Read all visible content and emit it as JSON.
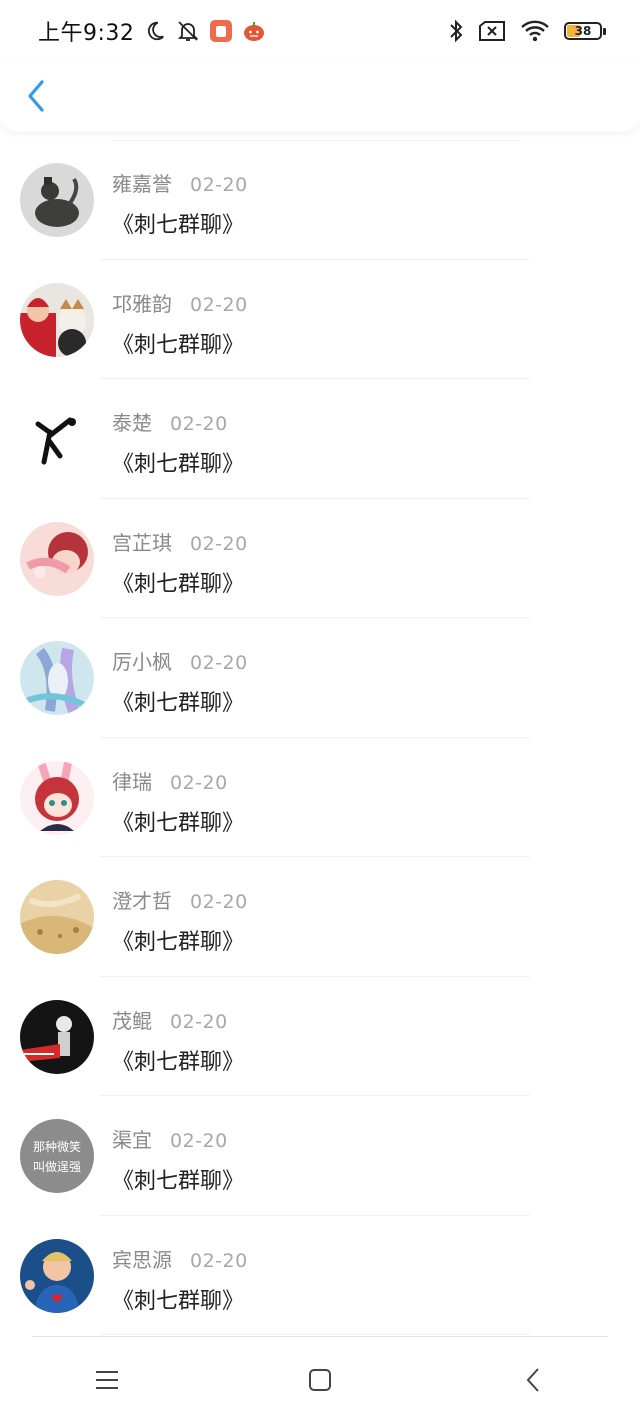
{
  "status_bar": {
    "time": "上午9:32",
    "battery_level": "38",
    "battery_fraction": 0.38,
    "icons": [
      "moon-icon",
      "bell-off-icon",
      "app-notification-icon",
      "pumpkin-icon",
      "bluetooth-icon",
      "sim-off-icon",
      "wifi-icon",
      "battery-icon"
    ]
  },
  "header": {
    "back_icon": "chevron-left-icon",
    "accent_color": "#2f9bf0"
  },
  "messages": [
    {
      "name": "雍嘉誉",
      "date": "02-20",
      "text": "《刺七群聊》",
      "avatar": "bronze-statue"
    },
    {
      "name": "邛雅韵",
      "date": "02-20",
      "text": "《刺七群聊》",
      "avatar": "baby-with-dog"
    },
    {
      "name": "泰楚",
      "date": "02-20",
      "text": "《刺七群聊》",
      "avatar": "ink-figure"
    },
    {
      "name": "宫芷琪",
      "date": "02-20",
      "text": "《刺七群聊》",
      "avatar": "pink-illustration"
    },
    {
      "name": "厉小枫",
      "date": "02-20",
      "text": "《刺七群聊》",
      "avatar": "blue-anime"
    },
    {
      "name": "律瑞",
      "date": "02-20",
      "text": "《刺七群聊》",
      "avatar": "red-hair-anime"
    },
    {
      "name": "澄才哲",
      "date": "02-20",
      "text": "《刺七群聊》",
      "avatar": "golden-scene"
    },
    {
      "name": "茂鲲",
      "date": "02-20",
      "text": "《刺七群聊》",
      "avatar": "dark-figure"
    },
    {
      "name": "渠宜",
      "date": "02-20",
      "text": "《刺七群聊》",
      "avatar": "text-avatar",
      "avatar_text_line1": "那种微笑",
      "avatar_text_line2": "叫做逞强"
    },
    {
      "name": "宾思源",
      "date": "02-20",
      "text": "《刺七群聊》",
      "avatar": "boy-superman"
    }
  ],
  "nav_bar": {
    "icons": [
      "menu-icon",
      "home-square-icon",
      "back-triangle-icon"
    ]
  }
}
